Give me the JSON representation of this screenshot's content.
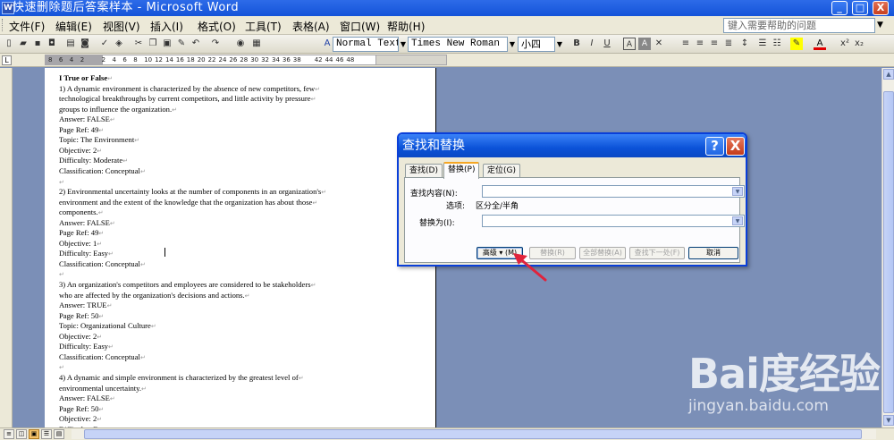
{
  "window": {
    "title": "快速删除题后答案样本 - Microsoft Word",
    "controls": {
      "minimize": "_",
      "maximize": "□",
      "close": "X"
    }
  },
  "menu": {
    "items": [
      "文件(F)",
      "编辑(E)",
      "视图(V)",
      "插入(I)",
      "格式(O)",
      "工具(T)",
      "表格(A)",
      "窗口(W)",
      "帮助(H)"
    ],
    "help_placeholder": "键入需要帮助的问题"
  },
  "toolbar": {
    "style": "Normal Text",
    "font": "Times New Roman",
    "size": "小四",
    "bold": "B",
    "italic": "I",
    "underline": "U",
    "font_color_letter": "A"
  },
  "ruler": {
    "numbers": [
      "8",
      "6",
      "4",
      "2",
      "2",
      "4",
      "6",
      "8",
      "10",
      "12",
      "14",
      "16",
      "18",
      "20",
      "22",
      "24",
      "26",
      "28",
      "30",
      "32",
      "34",
      "36",
      "38",
      "42",
      "44",
      "46",
      "48"
    ]
  },
  "document": {
    "lines": [
      {
        "text": "I  True or False",
        "bold": true
      },
      {
        "text": "1) A dynamic environment is characterized by the absence of new competitors, few"
      },
      {
        "text": "technological breakthroughs by current competitors, and little activity by pressure"
      },
      {
        "text": "groups to influence the organization."
      },
      {
        "text": "Answer:   FALSE"
      },
      {
        "text": "Page Ref: 49"
      },
      {
        "text": "Topic:    The Environment"
      },
      {
        "text": "Objective:    2"
      },
      {
        "text": "Difficulty:    Moderate"
      },
      {
        "text": "Classification:    Conceptual"
      },
      {
        "text": ""
      },
      {
        "text": "2) Environmental uncertainty looks at the number of components in an organization's"
      },
      {
        "text": "environment and the extent of the knowledge that the organization has about those"
      },
      {
        "text": "components."
      },
      {
        "text": "Answer:   FALSE"
      },
      {
        "text": "Page Ref: 49"
      },
      {
        "text": "Objective:    1"
      },
      {
        "text": "Difficulty:    Easy"
      },
      {
        "text": "Classification:    Conceptual"
      },
      {
        "text": ""
      },
      {
        "text": "3) An organization's competitors and employees are considered to be stakeholders"
      },
      {
        "text": "who are affected by the organization's decisions and actions."
      },
      {
        "text": "Answer:   TRUE"
      },
      {
        "text": "Page Ref: 50"
      },
      {
        "text": "Topic:    Organizational Culture"
      },
      {
        "text": "Objective:    2"
      },
      {
        "text": "Difficulty:    Easy"
      },
      {
        "text": "Classification:    Conceptual"
      },
      {
        "text": ""
      },
      {
        "text": "4) A dynamic and simple environment is characterized by the greatest level of"
      },
      {
        "text": "environmental uncertainty."
      },
      {
        "text": "Answer:   FALSE"
      },
      {
        "text": "Page Ref: 50"
      },
      {
        "text": "Objective:    2"
      },
      {
        "text": "Difficulty:    Easy"
      }
    ],
    "paragraph_mark": "↵"
  },
  "dialog": {
    "title": "查找和替换",
    "help_button": "?",
    "close_button": "X",
    "tabs": [
      "查找(D)",
      "替换(P)",
      "定位(G)"
    ],
    "active_tab": "替换(P)",
    "find_label": "查找内容(N):",
    "options_label": "选项:",
    "options_value": "区分全/半角",
    "replace_label": "替换为(I):",
    "find_value": "",
    "replace_value": "",
    "buttons": {
      "advanced": "高级 ▾ (M)",
      "replace": "替换(R)",
      "replace_all": "全部替换(A)",
      "find_next": "查找下一处(F)",
      "cancel": "取消"
    }
  },
  "accent_colors": {
    "titlebar": "#1453d9",
    "arrow": "#e0233c"
  },
  "watermark": {
    "logo": "Bai度经验",
    "url": "jingyan.baidu.com"
  }
}
